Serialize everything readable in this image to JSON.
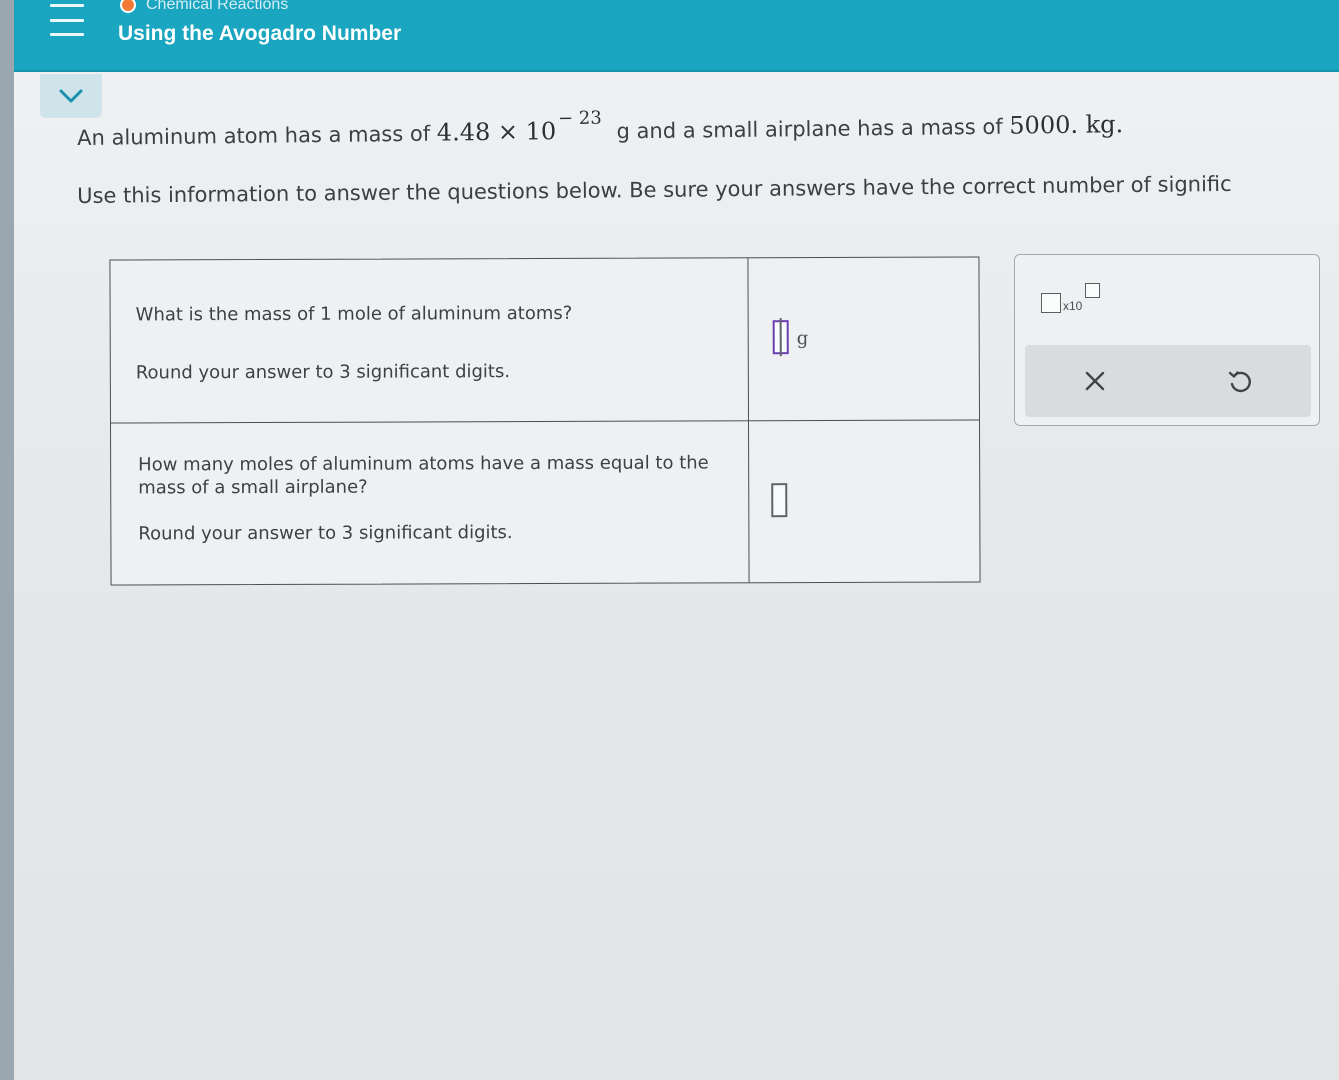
{
  "header": {
    "topic_label": "Chemical Reactions",
    "lesson_title": "Using the Avogadro Number",
    "accent_color": "#1aa5c0",
    "topic_dot_color": "#f07a36"
  },
  "problem": {
    "stem_before": "An aluminum atom has a mass of",
    "atom_mass_mantissa": "4.48 × 10",
    "atom_mass_exponent": "− 23",
    "stem_middle": "g and a small airplane has a mass of",
    "airplane_mass": "5000. kg.",
    "instructions": "Use this information to answer the questions below. Be sure your answers have the correct number of signific"
  },
  "questions": [
    {
      "prompt": "What is the mass of 1 mole of aluminum atoms?",
      "rounding": "Round your answer to 3 significant digits.",
      "unit": "g",
      "value": ""
    },
    {
      "prompt": "How many moles of aluminum atoms have a mass equal to the mass of a small airplane?",
      "rounding": "Round your answer to 3 significant digits.",
      "unit": "",
      "value": ""
    }
  ],
  "toolbox": {
    "sci_notation_label": "x10",
    "clear_icon": "close-icon",
    "undo_icon": "undo-icon"
  }
}
